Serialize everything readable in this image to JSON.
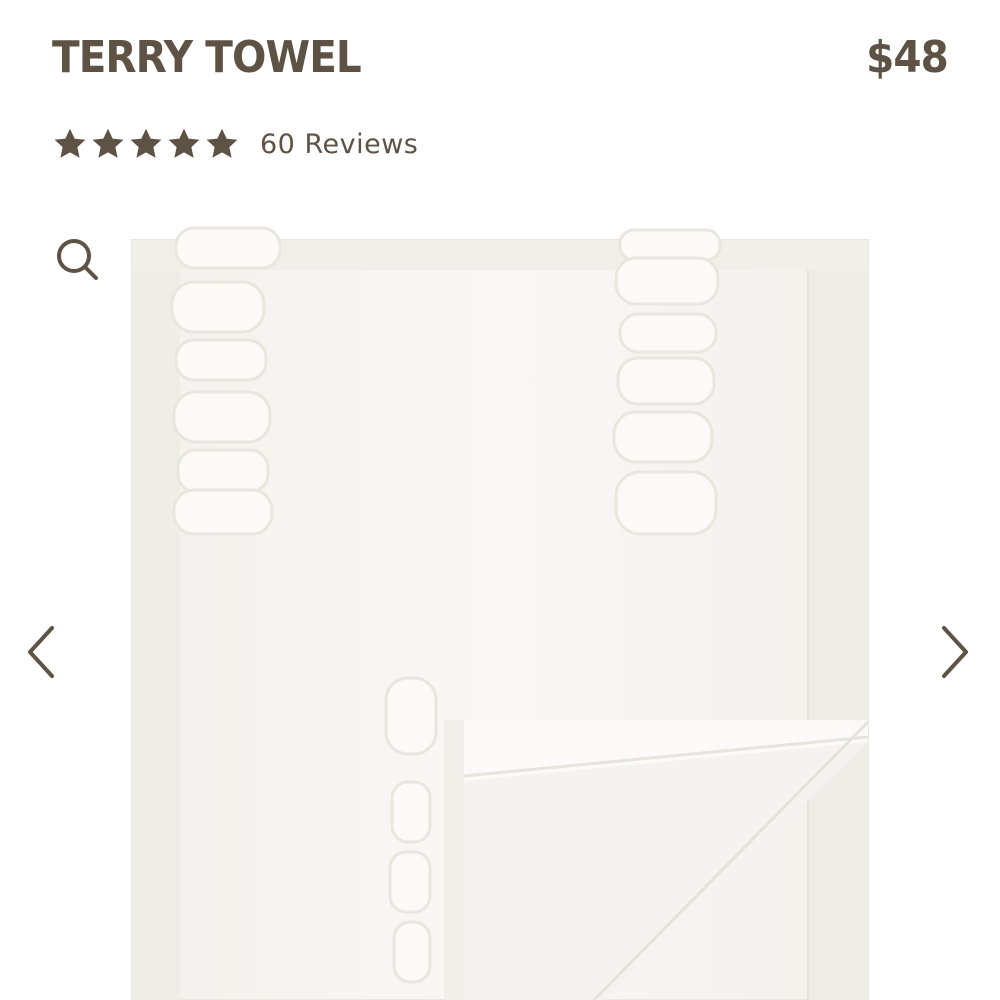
{
  "product": {
    "title": "TERRY TOWEL",
    "price": "$48"
  },
  "rating": {
    "stars": 5,
    "reviews_label": "60 Reviews"
  },
  "gallery": {
    "zoom_icon": "search-icon",
    "prev_icon": "chevron-left-icon",
    "next_icon": "chevron-right-icon"
  },
  "colors": {
    "brand_text": "#5e5244",
    "background": "#ffffff",
    "towel": "#f7f5f1"
  }
}
